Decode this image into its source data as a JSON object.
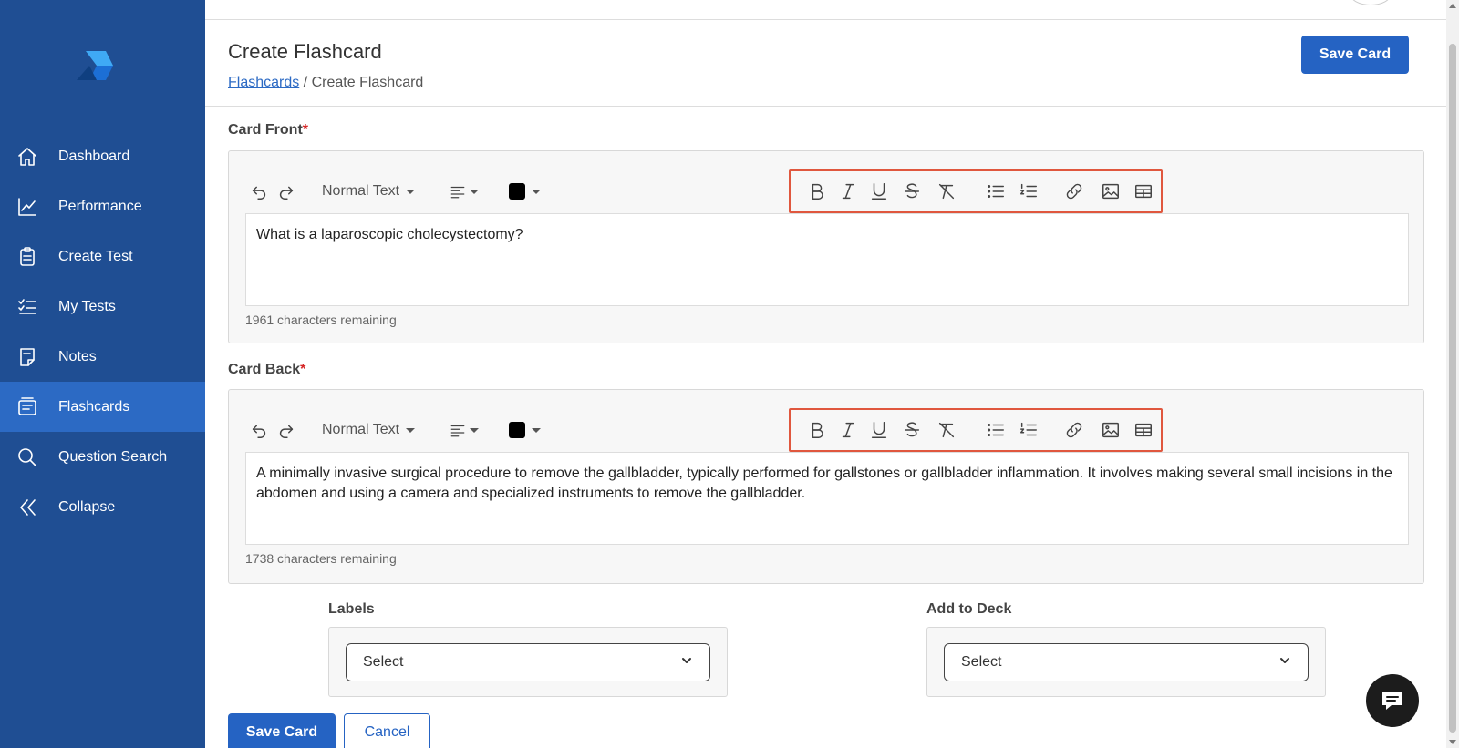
{
  "sidebar": {
    "items": [
      {
        "label": "Dashboard",
        "icon": "home-icon"
      },
      {
        "label": "Performance",
        "icon": "line-chart-icon"
      },
      {
        "label": "Create Test",
        "icon": "clipboard-icon"
      },
      {
        "label": "My Tests",
        "icon": "checklist-icon"
      },
      {
        "label": "Notes",
        "icon": "note-icon"
      },
      {
        "label": "Flashcards",
        "icon": "flashcards-icon",
        "active": true
      },
      {
        "label": "Question Search",
        "icon": "search-icon"
      },
      {
        "label": "Collapse",
        "icon": "double-chevron-left-icon"
      }
    ]
  },
  "header": {
    "title": "Create Flashcard",
    "breadcrumb_link": "Flashcards",
    "breadcrumb_sep": " / ",
    "breadcrumb_current": "Create Flashcard",
    "save_label": "Save Card"
  },
  "card_front": {
    "label": "Card Front",
    "required_mark": "*",
    "text_style": "Normal Text",
    "content": "What is a laparoscopic cholecystectomy?",
    "remaining": "1961 characters remaining"
  },
  "card_back": {
    "label": "Card Back",
    "required_mark": "*",
    "text_style": "Normal Text",
    "content": "A minimally invasive surgical procedure to remove the gallbladder, typically performed for gallstones or gallbladder inflammation. It involves making several small incisions in the abdomen and using a camera and specialized instruments to remove the gallbladder.",
    "remaining": "1738 characters remaining"
  },
  "labels": {
    "label": "Labels",
    "placeholder": "Select"
  },
  "deck": {
    "label": "Add to Deck",
    "placeholder": "Select"
  },
  "actions": {
    "save_label": "Save Card",
    "cancel_label": "Cancel"
  },
  "colors": {
    "sidebar_bg": "#1f4e93",
    "sidebar_active": "#2c6ac4",
    "primary": "#2563c3",
    "highlight": "#e0573e"
  }
}
